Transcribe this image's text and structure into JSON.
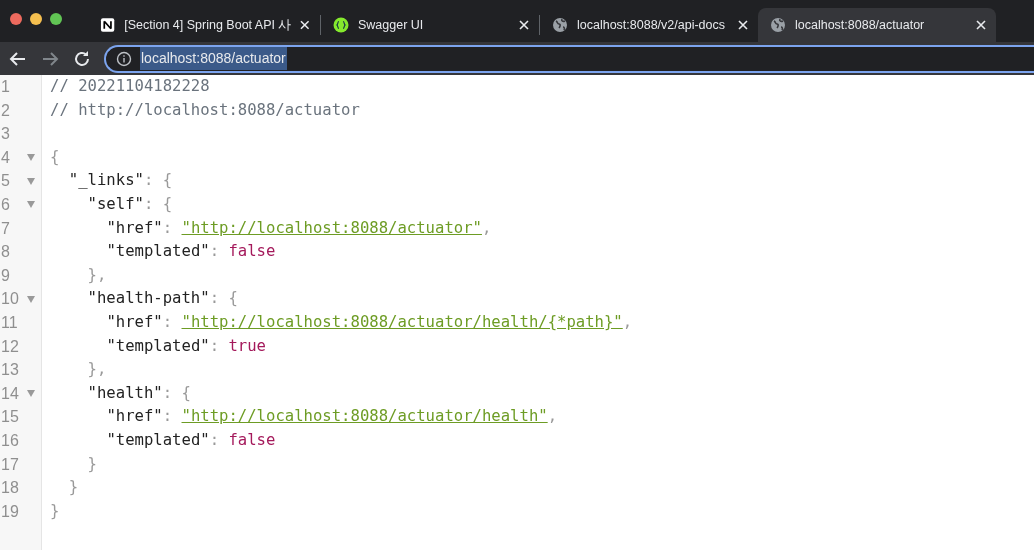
{
  "tabs": [
    {
      "kind": "notion",
      "title": "[Section 4] Spring Boot API 사",
      "selected": false
    },
    {
      "kind": "swagger",
      "title": "Swagger UI",
      "selected": false
    },
    {
      "kind": "globe",
      "title": "localhost:8088/v2/api-docs",
      "selected": false
    },
    {
      "kind": "globe",
      "title": "localhost:8088/actuator",
      "selected": true
    }
  ],
  "address_bar": {
    "url": "localhost:8088/actuator",
    "text_selected": true
  },
  "code_lines": [
    {
      "number": "1",
      "foldable": false,
      "tokens": [
        {
          "kind": "comment",
          "text": "// 20221104182228"
        }
      ]
    },
    {
      "number": "2",
      "foldable": false,
      "tokens": [
        {
          "kind": "comment",
          "text": "// http://localhost:8088/actuator"
        }
      ]
    },
    {
      "number": "3",
      "foldable": false
    },
    {
      "number": "4",
      "foldable": true,
      "tokens": [
        {
          "kind": "punct",
          "text": "{"
        }
      ]
    },
    {
      "number": "5",
      "foldable": true,
      "tokens": [
        {
          "kind": "key",
          "text": "\"_links\""
        },
        {
          "kind": "punct",
          "text": ": {"
        }
      ]
    },
    {
      "number": "6",
      "foldable": true,
      "tokens": [
        {
          "kind": "key",
          "text": "\"self\""
        },
        {
          "kind": "punct",
          "text": ": {"
        }
      ]
    },
    {
      "number": "7",
      "foldable": false,
      "tokens": [
        {
          "kind": "key",
          "text": "\"href\""
        },
        {
          "kind": "punct",
          "text": ": "
        },
        {
          "kind": "link",
          "text": "\"http://localhost:8088/actuator\""
        },
        {
          "kind": "punct",
          "text": ","
        }
      ]
    },
    {
      "number": "8",
      "foldable": false,
      "tokens": [
        {
          "kind": "key",
          "text": "\"templated\""
        },
        {
          "kind": "punct",
          "text": ": "
        },
        {
          "kind": "bool",
          "text": "false"
        }
      ]
    },
    {
      "number": "9",
      "foldable": false,
      "tokens": [
        {
          "kind": "punct",
          "text": "},"
        }
      ]
    },
    {
      "number": "10",
      "foldable": true,
      "tokens": [
        {
          "kind": "key",
          "text": "\"health-path\""
        },
        {
          "kind": "punct",
          "text": ": {"
        }
      ]
    },
    {
      "number": "11",
      "foldable": false,
      "tokens": [
        {
          "kind": "key",
          "text": "\"href\""
        },
        {
          "kind": "punct",
          "text": ": "
        },
        {
          "kind": "link",
          "text": "\"http://localhost:8088/actuator/health/{*path}\""
        },
        {
          "kind": "punct",
          "text": ","
        }
      ]
    },
    {
      "number": "12",
      "foldable": false,
      "tokens": [
        {
          "kind": "key",
          "text": "\"templated\""
        },
        {
          "kind": "punct",
          "text": ": "
        },
        {
          "kind": "bool",
          "text": "true"
        }
      ]
    },
    {
      "number": "13",
      "foldable": false,
      "tokens": [
        {
          "kind": "punct",
          "text": "},"
        }
      ]
    },
    {
      "number": "14",
      "foldable": true,
      "tokens": [
        {
          "kind": "key",
          "text": "\"health\""
        },
        {
          "kind": "punct",
          "text": ": {"
        }
      ]
    },
    {
      "number": "15",
      "foldable": false,
      "tokens": [
        {
          "kind": "key",
          "text": "\"href\""
        },
        {
          "kind": "punct",
          "text": ": "
        },
        {
          "kind": "link",
          "text": "\"http://localhost:8088/actuator/health\""
        },
        {
          "kind": "punct",
          "text": ","
        }
      ]
    },
    {
      "number": "16",
      "foldable": false,
      "tokens": [
        {
          "kind": "key",
          "text": "\"templated\""
        },
        {
          "kind": "punct",
          "text": ": "
        },
        {
          "kind": "bool",
          "text": "false"
        }
      ]
    },
    {
      "number": "17",
      "foldable": false,
      "tokens": [
        {
          "kind": "punct",
          "text": "}"
        }
      ]
    },
    {
      "number": "18",
      "foldable": false,
      "tokens": [
        {
          "kind": "punct",
          "text": "}"
        }
      ]
    },
    {
      "number": "19",
      "foldable": false,
      "tokens": [
        {
          "kind": "punct",
          "text": "}"
        }
      ]
    }
  ]
}
